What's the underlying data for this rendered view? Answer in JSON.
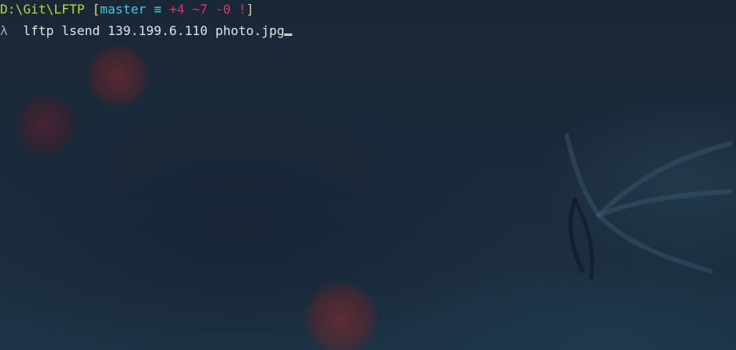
{
  "prompt": {
    "path": "D:\\Git\\LFTP",
    "open_bracket": "[",
    "branch": "master",
    "sync_symbol": "≡",
    "added": "+4",
    "modified": "~7",
    "deleted": "-0",
    "conflict": "!",
    "close_bracket": "]"
  },
  "input_line": {
    "lambda": "λ",
    "command": "lftp lsend 139.199.6.110 photo.jpg"
  },
  "colors": {
    "path": "#b6d443",
    "bracket": "#e6d36a",
    "branch": "#49c3dc",
    "status": "#d13c62",
    "command": "#dfe3e7",
    "background": "#1b2a3a"
  }
}
